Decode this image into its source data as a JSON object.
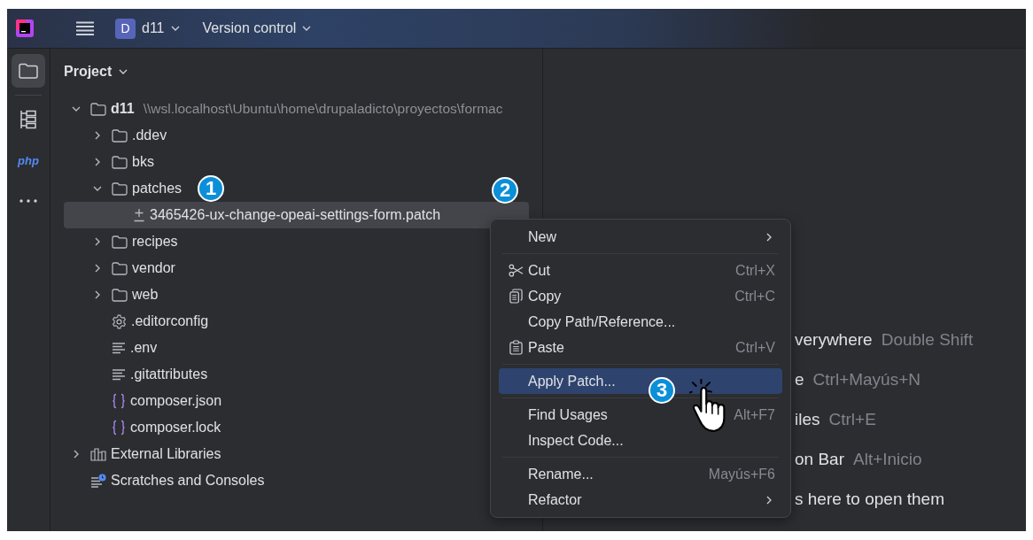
{
  "header": {
    "project_initial": "D",
    "project_name": "d11",
    "vcs_label": "Version control"
  },
  "toolstrip": {
    "items": [
      {
        "kind": "folder",
        "selected": true
      },
      {
        "kind": "structure",
        "selected": false
      },
      {
        "kind": "php",
        "label": "php",
        "selected": false
      },
      {
        "kind": "more",
        "selected": false
      }
    ]
  },
  "project": {
    "title": "Project",
    "tree": [
      {
        "name": "d11",
        "path": "\\\\wsl.localhost\\Ubuntu\\home\\drupaladicto\\proyectos\\formac",
        "kind": "folder",
        "expanded": true,
        "selected": false,
        "children": [
          {
            "name": ".ddev",
            "kind": "folder",
            "expanded": false,
            "selected": false
          },
          {
            "name": "bks",
            "kind": "folder",
            "expanded": false,
            "selected": false
          },
          {
            "name": "patches",
            "kind": "folder",
            "expanded": true,
            "selected": false,
            "children": [
              {
                "name": "3465426-ux-change-opeai-settings-form.patch",
                "kind": "patch",
                "selected": true
              }
            ]
          },
          {
            "name": "recipes",
            "kind": "folder",
            "expanded": false,
            "selected": false
          },
          {
            "name": "vendor",
            "kind": "folder",
            "expanded": false,
            "selected": false
          },
          {
            "name": "web",
            "kind": "folder",
            "expanded": false,
            "selected": false
          },
          {
            "name": ".editorconfig",
            "kind": "config",
            "selected": false
          },
          {
            "name": ".env",
            "kind": "text",
            "selected": false
          },
          {
            "name": ".gitattributes",
            "kind": "text",
            "selected": false
          },
          {
            "name": "composer.json",
            "kind": "json",
            "selected": false
          },
          {
            "name": "composer.lock",
            "kind": "json",
            "selected": false
          }
        ]
      },
      {
        "name": "External Libraries",
        "kind": "library",
        "expanded": false,
        "selected": false
      },
      {
        "name": "Scratches and Consoles",
        "kind": "scratches",
        "selected": false
      }
    ]
  },
  "context_menu": {
    "items": [
      {
        "kind": "item",
        "label": "New",
        "submenu": true,
        "selected": false
      },
      {
        "kind": "separator"
      },
      {
        "kind": "item",
        "label": "Cut",
        "shortcut": "Ctrl+X",
        "selected": false
      },
      {
        "kind": "item",
        "label": "Copy",
        "shortcut": "Ctrl+C",
        "selected": false
      },
      {
        "kind": "item",
        "label": "Copy Path/Reference...",
        "selected": false
      },
      {
        "kind": "item",
        "label": "Paste",
        "shortcut": "Ctrl+V",
        "selected": false
      },
      {
        "kind": "separator"
      },
      {
        "kind": "item",
        "label": "Apply Patch...",
        "selected": true
      },
      {
        "kind": "separator"
      },
      {
        "kind": "item",
        "label": "Find Usages",
        "shortcut": "Alt+F7",
        "selected": false
      },
      {
        "kind": "item",
        "label": "Inspect Code...",
        "selected": false
      },
      {
        "kind": "separator"
      },
      {
        "kind": "item",
        "label": "Rename...",
        "shortcut": "Mayús+F6",
        "selected": false
      },
      {
        "kind": "item",
        "label": "Refactor",
        "submenu": true,
        "selected": false
      }
    ]
  },
  "editor_hints": [
    {
      "action": "verywhere",
      "shortcut": "Double Shift"
    },
    {
      "action": "e",
      "shortcut": "Ctrl+Mayús+N"
    },
    {
      "action": "iles",
      "shortcut": "Ctrl+E"
    },
    {
      "action": "on Bar",
      "shortcut": "Alt+Inicio"
    },
    {
      "action": "s here to open them"
    }
  ],
  "annotations": [
    {
      "label": "1"
    },
    {
      "label": "2"
    },
    {
      "label": "3"
    }
  ]
}
